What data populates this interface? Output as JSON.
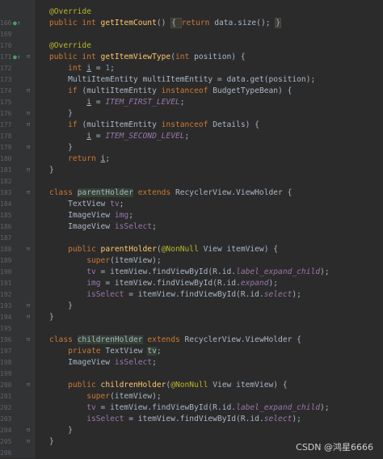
{
  "editor": {
    "lines": [
      {
        "n": "",
        "marker": "",
        "tokens": [
          {
            "t": "@Override",
            "c": "ann"
          }
        ]
      },
      {
        "n": "166",
        "marker": "override",
        "tokens": [
          {
            "t": "public int ",
            "c": "kw"
          },
          {
            "t": "getItemCount",
            "c": "fn"
          },
          {
            "t": "() "
          },
          {
            "t": "{ ",
            "c": "hl"
          },
          {
            "t": "return ",
            "c": "kw"
          },
          {
            "t": "data"
          },
          {
            "t": ".size(); "
          },
          {
            "t": "}",
            "c": "hl"
          }
        ]
      },
      {
        "n": "169",
        "marker": "",
        "tokens": []
      },
      {
        "n": "170",
        "marker": "",
        "tokens": [
          {
            "t": "@Override",
            "c": "ann"
          }
        ]
      },
      {
        "n": "171",
        "marker": "override",
        "tokens": [
          {
            "t": "public int ",
            "c": "kw"
          },
          {
            "t": "getItemViewType",
            "c": "fn"
          },
          {
            "t": "("
          },
          {
            "t": "int ",
            "c": "kw"
          },
          {
            "t": "position) {"
          }
        ]
      },
      {
        "n": "172",
        "marker": "",
        "tokens": [
          {
            "t": "    "
          },
          {
            "t": "int ",
            "c": "kw"
          },
          {
            "t": "i",
            "c": "under"
          },
          {
            "t": " = "
          },
          {
            "t": "1",
            "c": "num"
          },
          {
            "t": ";"
          }
        ]
      },
      {
        "n": "173",
        "marker": "",
        "tokens": [
          {
            "t": "    MultiItemEntity multiItemEntity = "
          },
          {
            "t": "data"
          },
          {
            "t": ".get(position);"
          }
        ]
      },
      {
        "n": "174",
        "marker": "",
        "tokens": [
          {
            "t": "    "
          },
          {
            "t": "if ",
            "c": "kw"
          },
          {
            "t": "(multiItemEntity "
          },
          {
            "t": "instanceof ",
            "c": "kw"
          },
          {
            "t": "BudgetTypeBean) {"
          }
        ]
      },
      {
        "n": "175",
        "marker": "",
        "tokens": [
          {
            "t": "        "
          },
          {
            "t": "i",
            "c": "under"
          },
          {
            "t": " = "
          },
          {
            "t": "ITEM_FIRST_LEVEL",
            "c": "const"
          },
          {
            "t": ";"
          }
        ]
      },
      {
        "n": "176",
        "marker": "",
        "tokens": [
          {
            "t": "    }"
          }
        ]
      },
      {
        "n": "177",
        "marker": "",
        "tokens": [
          {
            "t": "    "
          },
          {
            "t": "if ",
            "c": "kw"
          },
          {
            "t": "(multiItemEntity "
          },
          {
            "t": "instanceof ",
            "c": "kw"
          },
          {
            "t": "Details) {"
          }
        ]
      },
      {
        "n": "178",
        "marker": "",
        "tokens": [
          {
            "t": "        "
          },
          {
            "t": "i",
            "c": "under"
          },
          {
            "t": " = "
          },
          {
            "t": "ITEM_SECOND_LEVEL",
            "c": "const"
          },
          {
            "t": ";"
          }
        ]
      },
      {
        "n": "179",
        "marker": "",
        "tokens": [
          {
            "t": "    }"
          }
        ]
      },
      {
        "n": "180",
        "marker": "",
        "tokens": [
          {
            "t": "    "
          },
          {
            "t": "return ",
            "c": "kw"
          },
          {
            "t": "i",
            "c": "under"
          },
          {
            "t": ";"
          }
        ]
      },
      {
        "n": "181",
        "marker": "",
        "tokens": [
          {
            "t": "}"
          }
        ]
      },
      {
        "n": "182",
        "marker": "",
        "tokens": []
      },
      {
        "n": "183",
        "marker": "",
        "tokens": [
          {
            "t": "class ",
            "c": "kw"
          },
          {
            "t": "parentHolder",
            "c": "hlcls"
          },
          {
            "t": " "
          },
          {
            "t": "extends ",
            "c": "kw"
          },
          {
            "t": "RecyclerView.ViewHolder {"
          }
        ]
      },
      {
        "n": "184",
        "marker": "",
        "tokens": [
          {
            "t": "    TextView "
          },
          {
            "t": "tv",
            "c": "field"
          },
          {
            "t": ";"
          }
        ]
      },
      {
        "n": "185",
        "marker": "",
        "tokens": [
          {
            "t": "    ImageView "
          },
          {
            "t": "img",
            "c": "field"
          },
          {
            "t": ";"
          }
        ]
      },
      {
        "n": "186",
        "marker": "",
        "tokens": [
          {
            "t": "    ImageView "
          },
          {
            "t": "isSelect",
            "c": "field"
          },
          {
            "t": ";"
          }
        ]
      },
      {
        "n": "187",
        "marker": "",
        "tokens": []
      },
      {
        "n": "188",
        "marker": "",
        "tokens": [
          {
            "t": "    "
          },
          {
            "t": "public ",
            "c": "kw"
          },
          {
            "t": "parentHolder",
            "c": "fn"
          },
          {
            "t": "("
          },
          {
            "t": "@NonNull ",
            "c": "ann"
          },
          {
            "t": "View itemView) {"
          }
        ]
      },
      {
        "n": "189",
        "marker": "",
        "tokens": [
          {
            "t": "        "
          },
          {
            "t": "super",
            "c": "kw"
          },
          {
            "t": "(itemView);"
          }
        ]
      },
      {
        "n": "190",
        "marker": "",
        "tokens": [
          {
            "t": "        "
          },
          {
            "t": "tv",
            "c": "field"
          },
          {
            "t": " = itemView.findViewById(R.id."
          },
          {
            "t": "label_expand_child",
            "c": "const"
          },
          {
            "t": ");"
          }
        ]
      },
      {
        "n": "191",
        "marker": "",
        "tokens": [
          {
            "t": "        "
          },
          {
            "t": "img",
            "c": "field"
          },
          {
            "t": " = itemView.findViewById(R.id."
          },
          {
            "t": "expand",
            "c": "const"
          },
          {
            "t": ");"
          }
        ]
      },
      {
        "n": "192",
        "marker": "",
        "tokens": [
          {
            "t": "        "
          },
          {
            "t": "isSelect",
            "c": "field"
          },
          {
            "t": " = itemView.findViewById(R.id."
          },
          {
            "t": "select",
            "c": "const"
          },
          {
            "t": ");"
          }
        ]
      },
      {
        "n": "193",
        "marker": "",
        "tokens": [
          {
            "t": "    }"
          }
        ]
      },
      {
        "n": "194",
        "marker": "",
        "tokens": [
          {
            "t": "}"
          }
        ]
      },
      {
        "n": "195",
        "marker": "",
        "tokens": []
      },
      {
        "n": "196",
        "marker": "",
        "tokens": [
          {
            "t": "class ",
            "c": "kw"
          },
          {
            "t": "childrenHolder",
            "c": "hlcls"
          },
          {
            "t": " "
          },
          {
            "t": "extends ",
            "c": "kw"
          },
          {
            "t": "RecyclerView.ViewHolder {"
          }
        ]
      },
      {
        "n": "197",
        "marker": "",
        "tokens": [
          {
            "t": "    "
          },
          {
            "t": "private ",
            "c": "kw"
          },
          {
            "t": "TextView "
          },
          {
            "t": "tv",
            "c": "hlcls"
          },
          {
            "t": ";"
          }
        ]
      },
      {
        "n": "198",
        "marker": "",
        "tokens": [
          {
            "t": "    ImageView "
          },
          {
            "t": "isSelect",
            "c": "field"
          },
          {
            "t": ";"
          }
        ]
      },
      {
        "n": "199",
        "marker": "",
        "tokens": []
      },
      {
        "n": "200",
        "marker": "",
        "tokens": [
          {
            "t": "    "
          },
          {
            "t": "public ",
            "c": "kw"
          },
          {
            "t": "childrenHolder",
            "c": "fn"
          },
          {
            "t": "("
          },
          {
            "t": "@NonNull ",
            "c": "ann"
          },
          {
            "t": "View itemView) {"
          }
        ]
      },
      {
        "n": "201",
        "marker": "",
        "tokens": [
          {
            "t": "        "
          },
          {
            "t": "super",
            "c": "kw"
          },
          {
            "t": "(itemView);"
          }
        ]
      },
      {
        "n": "202",
        "marker": "",
        "tokens": [
          {
            "t": "        "
          },
          {
            "t": "tv",
            "c": "field"
          },
          {
            "t": " = itemView.findViewById(R.id."
          },
          {
            "t": "label_expand_child",
            "c": "const"
          },
          {
            "t": ");"
          }
        ]
      },
      {
        "n": "203",
        "marker": "",
        "tokens": [
          {
            "t": "        "
          },
          {
            "t": "isSelect",
            "c": "field"
          },
          {
            "t": " = itemView.findViewById(R.id."
          },
          {
            "t": "select",
            "c": "const"
          },
          {
            "t": ");"
          }
        ]
      },
      {
        "n": "204",
        "marker": "",
        "tokens": [
          {
            "t": "    }"
          }
        ]
      },
      {
        "n": "205",
        "marker": "",
        "tokens": [
          {
            "t": "}"
          }
        ]
      },
      {
        "n": "206",
        "marker": "",
        "tokens": []
      }
    ]
  },
  "watermark": "CSDN @鸿星6666",
  "colors": {
    "background": "#2b2b2b",
    "keyword": "#cc7832",
    "annotation": "#bbb529",
    "function": "#ffc66d",
    "field": "#9876aa",
    "number": "#6897bb",
    "text": "#a9b7c6"
  }
}
